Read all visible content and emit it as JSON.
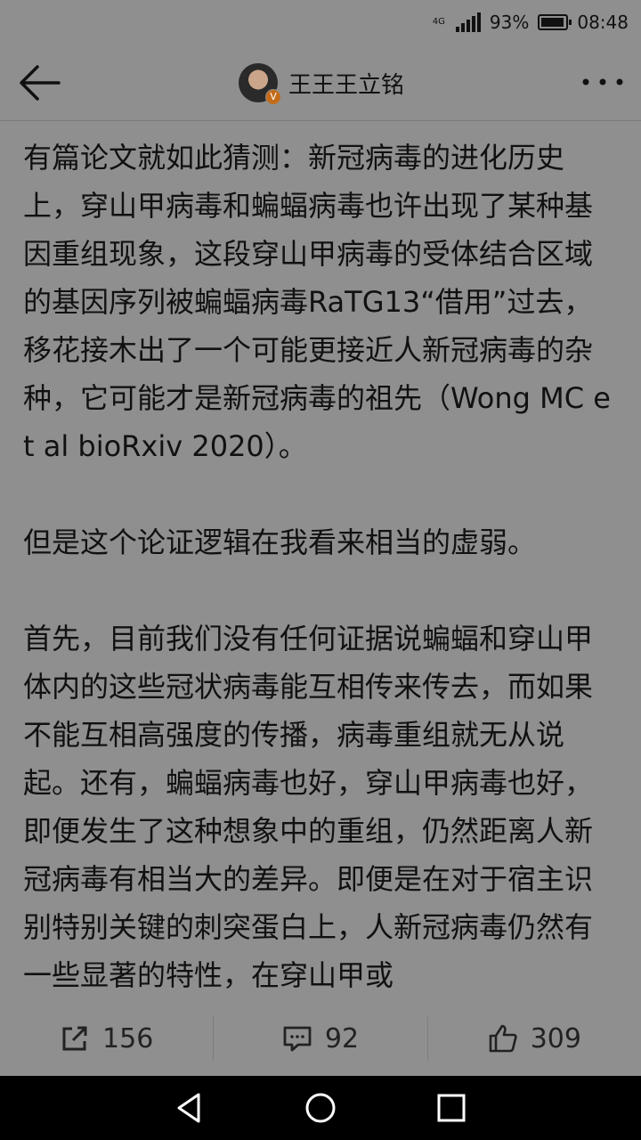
{
  "status_bar": {
    "network": "4G",
    "battery": "93%",
    "battery_level": 0.93,
    "time": "08:48"
  },
  "header": {
    "back_icon": "arrow-left-icon",
    "author_name": "王王王立铭",
    "verified_badge": "V",
    "more_icon": "more-dots-icon"
  },
  "article": {
    "paragraphs": [
      "有篇论文就如此猜测：新冠病毒的进化历史上，穿山甲病毒和蝙蝠病毒也许出现了某种基因重组现象，这段穿山甲病毒的受体结合区域的基因序列被蝙蝠病毒RaTG13“借用”过去，移花接木出了一个可能更接近人新冠病毒的杂种，它可能才是新冠病毒的祖先（Wong MC et al bioRxiv 2020）。",
      "但是这个论证逻辑在我看来相当的虚弱。",
      "首先，目前我们没有任何证据说蝙蝠和穿山甲体内的这些冠状病毒能互相传来传去，而如果不能互相高强度的传播，病毒重组就无从说起。还有，蝙蝠病毒也好，穿山甲病毒也好，即便发生了这种想象中的重组，仍然距离人新冠病毒有相当大的差异。即便是在对于宿主识别特别关键的刺突蛋白上，人新冠病毒仍然有一些显著的特性，在穿山甲或"
    ]
  },
  "actions": {
    "share_count": "156",
    "comment_count": "92",
    "like_count": "309"
  },
  "nav": {
    "back_icon": "nav-back-icon",
    "home_icon": "nav-home-icon",
    "recents_icon": "nav-recents-icon"
  }
}
